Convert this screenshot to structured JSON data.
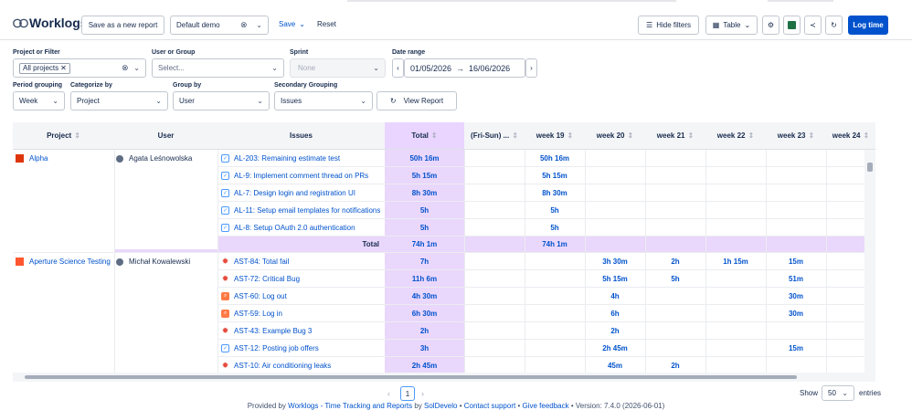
{
  "header": {
    "title": "Worklogs",
    "save_as_new": "Save as a new report",
    "report_select": "Default demo",
    "save": "Save",
    "reset": "Reset",
    "hide_filters": "Hide filters",
    "table_select": "Table",
    "log_time": "Log time"
  },
  "filters": {
    "project_label": "Project or Filter",
    "project_tag": "All projects",
    "user_label": "User or Group",
    "user_placeholder": "Select...",
    "sprint_label": "Sprint",
    "sprint_value": "None",
    "date_label": "Date range",
    "date_from": "01/05/2026",
    "date_arrow": "→",
    "date_to": "16/06/2026",
    "period_label": "Period grouping",
    "period_value": "Week",
    "categorize_label": "Categorize by",
    "categorize_value": "Project",
    "groupby_label": "Group by",
    "groupby_value": "User",
    "secondary_label": "Secondary Grouping",
    "secondary_value": "Issues",
    "view_report": "View Report"
  },
  "table": {
    "columns": [
      "Project",
      "User",
      "Issues",
      "Total",
      "(Fri-Sun) ...",
      "week 19",
      "week 20",
      "week 21",
      "week 22",
      "week 23",
      "week 24"
    ],
    "group1": {
      "project": "Alpha",
      "user": "Agata Leśnowolska",
      "rows": [
        {
          "issue": "AL-203: Remaining estimate test",
          "type": "task",
          "total": "50h 16m",
          "w19": "50h 16m"
        },
        {
          "issue": "AL-9: Implement comment thread on PRs",
          "type": "task",
          "total": "5h 15m",
          "w19": "5h 15m"
        },
        {
          "issue": "AL-7: Design login and registration UI",
          "type": "task",
          "total": "8h 30m",
          "w19": "8h 30m"
        },
        {
          "issue": "AL-11: Setup email templates for notifications",
          "type": "task",
          "total": "5h",
          "w19": "5h"
        },
        {
          "issue": "AL-8: Setup OAuth 2.0 authentication",
          "type": "task",
          "total": "5h",
          "w19": "5h"
        }
      ],
      "total_label": "Total",
      "total_value": "74h 1m",
      "total_w19": "74h 1m"
    },
    "group2": {
      "project": "Aperture Science Testing",
      "user": "Michał Kowalewski",
      "rows": [
        {
          "issue": "AST-84: Total fail",
          "type": "bug",
          "total": "7h",
          "w20": "3h 30m",
          "w21": "2h",
          "w22": "1h 15m",
          "w23": "15m"
        },
        {
          "issue": "AST-72: Critical Bug",
          "type": "bug",
          "total": "11h 6m",
          "w20": "5h 15m",
          "w21": "5h",
          "w22": "",
          "w23": "51m"
        },
        {
          "issue": "AST-60: Log out",
          "type": "story",
          "total": "4h 30m",
          "w20": "4h",
          "w21": "",
          "w22": "",
          "w23": "30m"
        },
        {
          "issue": "AST-59: Log in",
          "type": "story",
          "total": "6h 30m",
          "w20": "6h",
          "w21": "",
          "w22": "",
          "w23": "30m"
        },
        {
          "issue": "AST-43: Example Bug 3",
          "type": "bug",
          "total": "2h",
          "w20": "2h",
          "w21": "",
          "w22": "",
          "w23": ""
        },
        {
          "issue": "AST-12: Posting job offers",
          "type": "task",
          "total": "3h",
          "w20": "2h 45m",
          "w21": "",
          "w22": "",
          "w23": "15m"
        },
        {
          "issue": "AST-10: Air conditioning leaks",
          "type": "bug",
          "total": "2h 45m",
          "w20": "45m",
          "w21": "2h",
          "w22": "",
          "w23": ""
        }
      ]
    }
  },
  "pagination": {
    "prev": "‹",
    "page": "1",
    "next": "›",
    "show_label": "Show",
    "show_value": "50",
    "entries_label": "entries"
  },
  "footer": {
    "prefix": "Provided by",
    "product": "Worklogs - Time Tracking and Reports",
    "by": "by",
    "vendor": "SolDevelo",
    "contact": "Contact support",
    "feedback": "Give feedback",
    "version": "Version: 7.4.0 (2026-06-01)"
  },
  "colors": {
    "accent": "#0052cc",
    "total_column": "#ead7fc",
    "bug": "#e5493a",
    "story": "#ff7a45"
  }
}
